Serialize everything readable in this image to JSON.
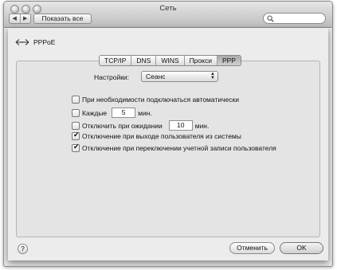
{
  "window": {
    "title": "Сеть"
  },
  "toolbar": {
    "back": "◀",
    "forward": "▶",
    "show_all": "Показать все",
    "search_placeholder": ""
  },
  "connection": {
    "name": "PPPoE"
  },
  "tabs": [
    {
      "label": "TCP/IP",
      "active": false
    },
    {
      "label": "DNS",
      "active": false
    },
    {
      "label": "WINS",
      "active": false
    },
    {
      "label": "Прокси",
      "active": false
    },
    {
      "label": "PPP",
      "active": true
    }
  ],
  "settings": {
    "label": "Настройки:",
    "value": "Сеанс"
  },
  "options": {
    "auto_connect": {
      "label": "При необходимости подключаться автоматически",
      "checked": false
    },
    "every": {
      "label": "Каждые",
      "value": "5",
      "unit": "мин.",
      "checked": false
    },
    "idle": {
      "label": "Отключить при ожидании",
      "value": "10",
      "unit": "мин.",
      "checked": false
    },
    "logout": {
      "label": "Отключение при выходе пользователя из системы",
      "checked": true
    },
    "switch_user": {
      "label": "Отключение при переключении учетной записи пользователя",
      "checked": true
    }
  },
  "buttons": {
    "help": "?",
    "cancel": "Отменить",
    "ok": "OK"
  }
}
